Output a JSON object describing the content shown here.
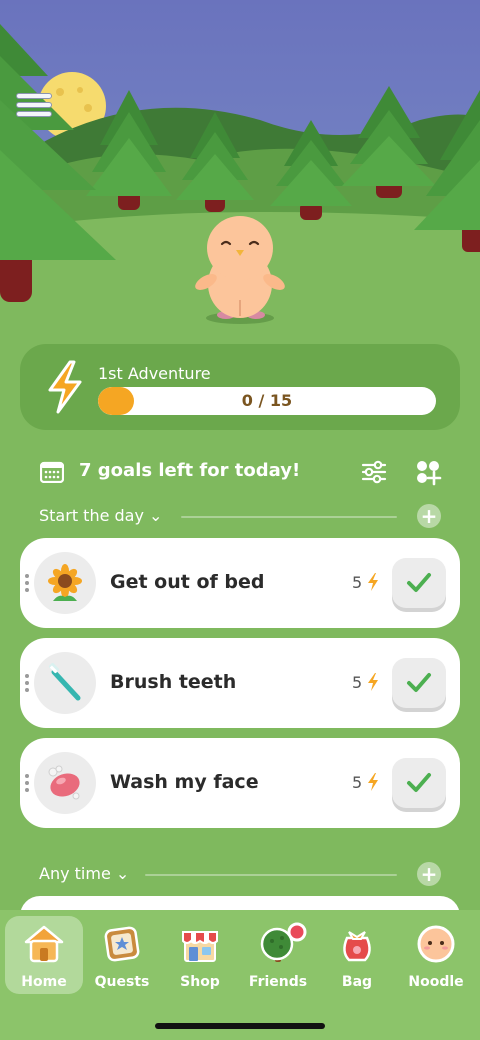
{
  "adventure": {
    "title": "1st Adventure",
    "progress_text": "0 / 15",
    "progress_current": 0,
    "progress_total": 15,
    "icon": "lightning-bolt-icon"
  },
  "goals_header": {
    "title": "7 goals left for today!",
    "icons": [
      "calendar-icon",
      "filter-sliders-icon",
      "add-apps-icon"
    ]
  },
  "sections": [
    {
      "label": "Start the day ⌄",
      "add": "+"
    },
    {
      "label": "Any time ⌄",
      "add": "+"
    }
  ],
  "goals": [
    {
      "name": "Get out of bed",
      "points": "5",
      "icon": "sunflower-icon"
    },
    {
      "name": "Brush teeth",
      "points": "5",
      "icon": "toothbrush-icon"
    },
    {
      "name": "Wash my face",
      "points": "5",
      "icon": "soap-icon"
    }
  ],
  "nav": [
    {
      "label": "Home",
      "icon": "house-icon",
      "active": true
    },
    {
      "label": "Quests",
      "icon": "quest-board-icon",
      "active": false
    },
    {
      "label": "Shop",
      "icon": "shop-icon",
      "active": false
    },
    {
      "label": "Friends",
      "icon": "tree-icon",
      "active": false
    },
    {
      "label": "Bag",
      "icon": "bag-icon",
      "active": false
    },
    {
      "label": "Noodle",
      "icon": "noodle-face-icon",
      "active": false
    }
  ],
  "colors": {
    "sky": "#6b78c4",
    "grass": "#7fb95e",
    "card": "#ffffff",
    "accent": "#f5a623",
    "check": "#4caf50"
  }
}
